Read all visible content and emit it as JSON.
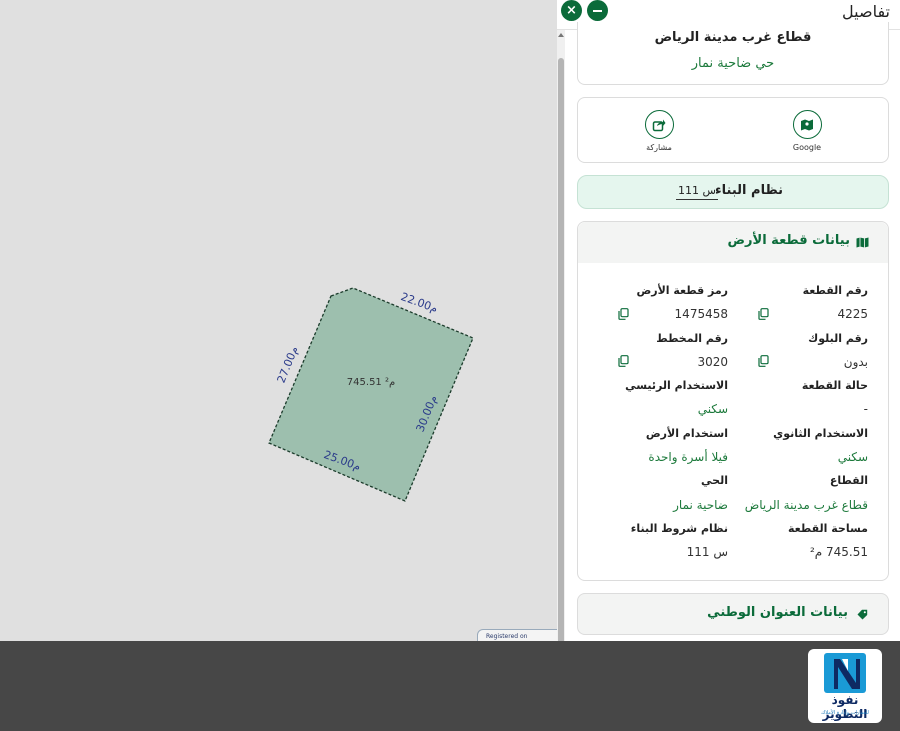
{
  "map": {
    "area_label": "745.51 م²",
    "edges": [
      "22.00م",
      "30.00م",
      "25.00م",
      "27.00م"
    ],
    "registered": "Registered on"
  },
  "panel": {
    "title": "تفاصيل",
    "close_glyph": "×",
    "sector_name": "قطاع غرب مدينة الرياض",
    "district": "حي ضاحية نمار",
    "actions": {
      "google": "Google",
      "share": "مشاركة"
    },
    "building_system": {
      "title": "نظام البناء",
      "value": "س 111"
    },
    "land": {
      "title": "بيانات قطعة الأرض",
      "fields": {
        "plot_number": {
          "label": "رقم القطعة",
          "value": "4225"
        },
        "plot_code": {
          "label": "رمز قطعة الأرض",
          "value": "1475458"
        },
        "block_number": {
          "label": "رقم البلوك",
          "value": "بدون"
        },
        "plan_number": {
          "label": "رقم المخطط",
          "value": "3020"
        },
        "plot_status": {
          "label": "حالة القطعة",
          "value": "-"
        },
        "main_use": {
          "label": "الاستخدام الرئيسي",
          "value": "سكني"
        },
        "secondary_use": {
          "label": "الاستخدام الثانوي",
          "value": "سكني"
        },
        "land_use": {
          "label": "استخدام الأرض",
          "value": "فيلا أسرة واحدة"
        },
        "sector": {
          "label": "القطاع",
          "value": "قطاع غرب مدينة الرياض"
        },
        "district": {
          "label": "الحي",
          "value": "ضاحية نمار"
        },
        "plot_area": {
          "label": "مساحة القطعة",
          "value": "745.51 م²"
        },
        "building_code": {
          "label": "نظام شروط البناء",
          "value": "س 111"
        }
      }
    },
    "national_address": {
      "title": "بيانات العنوان الوطني"
    }
  },
  "logo": {
    "name": "نفوذ التطوير",
    "subtitle": "للعقارات وإدارة الأملاك"
  },
  "colors": {
    "primary": "#0b6b3a",
    "parcel_fill": "#9dbfae",
    "accent_green": "#1d7a3c"
  }
}
